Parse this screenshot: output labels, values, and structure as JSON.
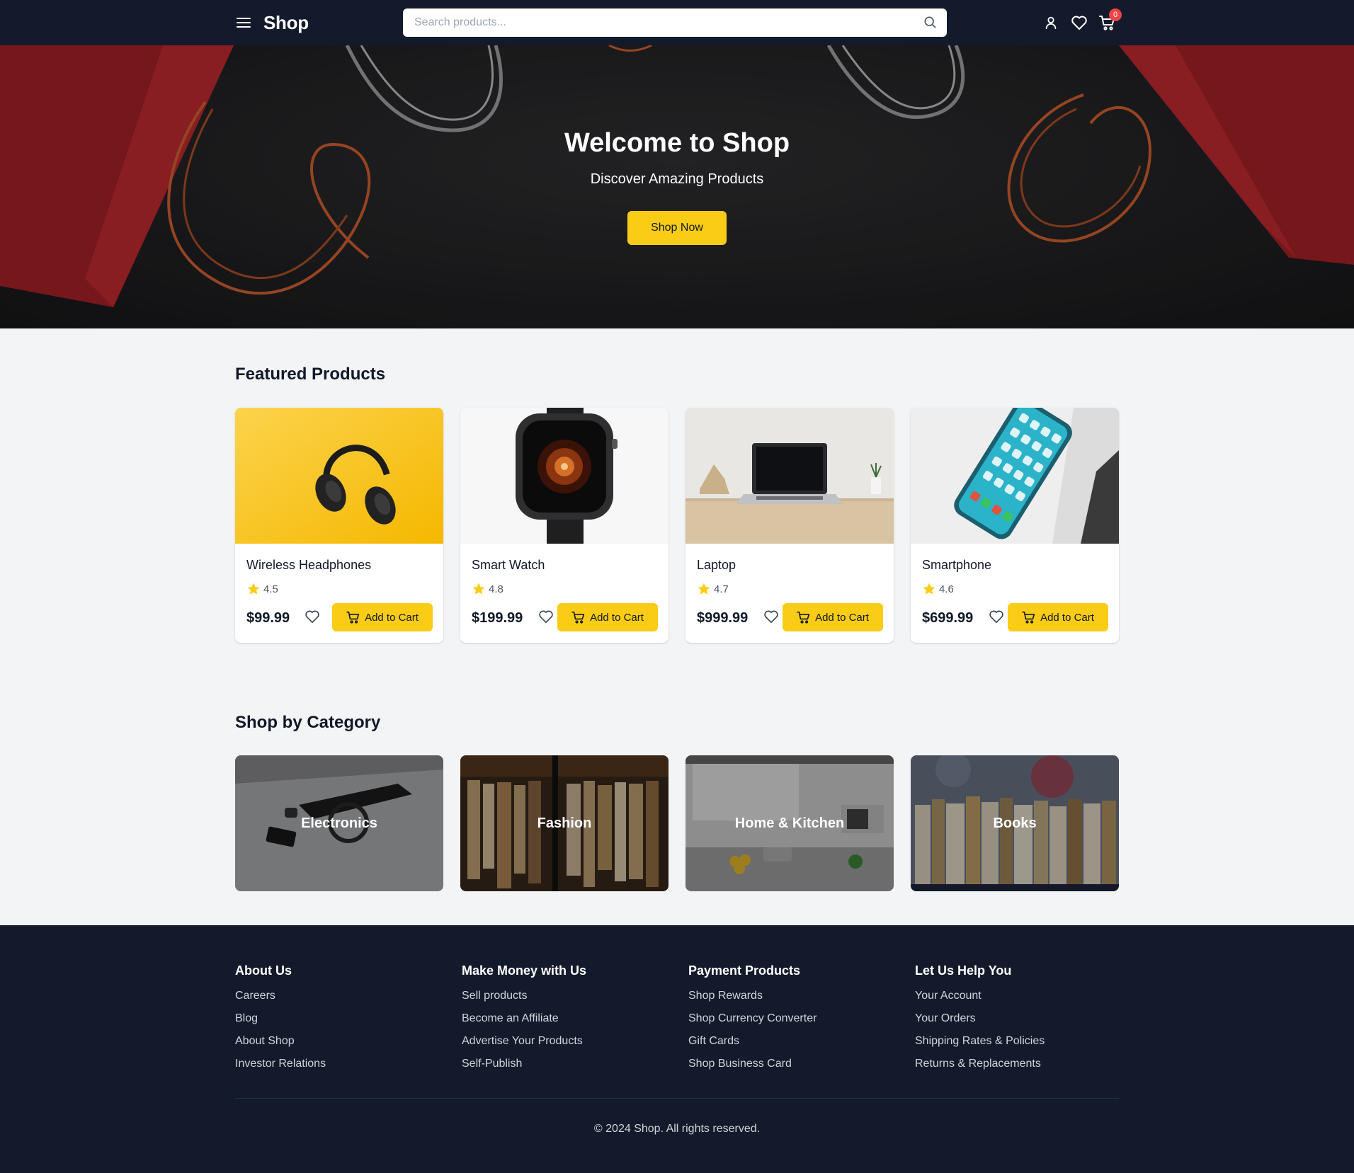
{
  "navbar": {
    "logo": "Shop",
    "search_placeholder": "Search products...",
    "search_value": "",
    "cart_count": "0"
  },
  "hero": {
    "title": "Welcome to Shop",
    "subtitle": "Discover Amazing Products",
    "button": "Shop Now"
  },
  "featured": {
    "title": "Featured Products",
    "products": [
      {
        "name": "Wireless Headphones",
        "rating": "4.5",
        "price": "$99.99",
        "cart_label": "Add to Cart"
      },
      {
        "name": "Smart Watch",
        "rating": "4.8",
        "price": "$199.99",
        "cart_label": "Add to Cart"
      },
      {
        "name": "Laptop",
        "rating": "4.7",
        "price": "$999.99",
        "cart_label": "Add to Cart"
      },
      {
        "name": "Smartphone",
        "rating": "4.6",
        "price": "$699.99",
        "cart_label": "Add to Cart"
      }
    ]
  },
  "categories": {
    "title": "Shop by Category",
    "items": [
      {
        "label": "Electronics"
      },
      {
        "label": "Fashion"
      },
      {
        "label": "Home & Kitchen"
      },
      {
        "label": "Books"
      }
    ]
  },
  "footer": {
    "columns": [
      {
        "heading": "About Us",
        "links": [
          "Careers",
          "Blog",
          "About Shop",
          "Investor Relations"
        ]
      },
      {
        "heading": "Make Money with Us",
        "links": [
          "Sell products",
          "Become an Affiliate",
          "Advertise Your Products",
          "Self-Publish"
        ]
      },
      {
        "heading": "Payment Products",
        "links": [
          "Shop Rewards",
          "Shop Currency Converter",
          "Gift Cards",
          "Shop Business Card"
        ]
      },
      {
        "heading": "Let Us Help You",
        "links": [
          "Your Account",
          "Your Orders",
          "Shipping Rates & Policies",
          "Returns & Replacements"
        ]
      }
    ],
    "copyright": "© 2024 Shop. All rights reserved."
  },
  "colors": {
    "navbar_bg": "#131a2b",
    "accent": "#facc15",
    "page_bg": "#f3f4f6",
    "badge": "#ef4444"
  },
  "icons": {
    "menu": "hamburger-menu-icon",
    "search": "search-icon",
    "account": "user-icon",
    "wishlist": "heart-icon",
    "cart": "cart-icon",
    "rating": "star-icon"
  }
}
